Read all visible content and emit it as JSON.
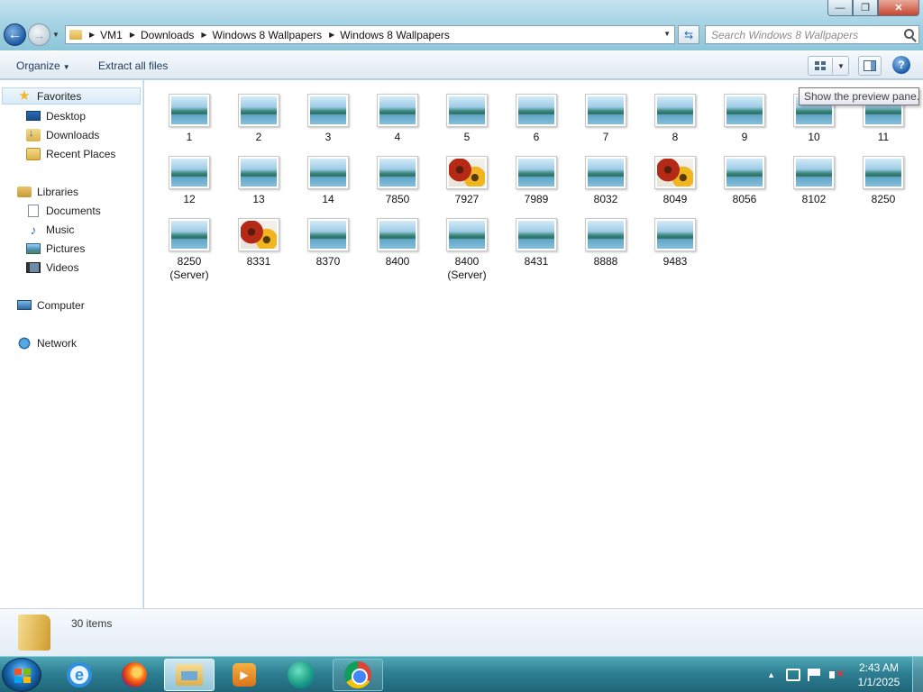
{
  "window": {
    "minimize_glyph": "—",
    "maximize_glyph": "❐",
    "close_glyph": "✕"
  },
  "nav": {
    "back_glyph": "←",
    "forward_glyph": "→",
    "history_glyph": "▼"
  },
  "address": {
    "crumbs": [
      "VM1",
      "Downloads",
      "Windows 8 Wallpapers",
      "Windows 8 Wallpapers"
    ],
    "separator_glyph": "▶",
    "dropdown_glyph": "▼",
    "refresh_glyph": "⇆"
  },
  "search": {
    "placeholder": "Search Windows 8 Wallpapers"
  },
  "toolbar": {
    "organize_label": "Organize",
    "caret_glyph": "▼",
    "extract_label": "Extract all files",
    "help_glyph": "?"
  },
  "tooltip": {
    "text": "Show the preview pane."
  },
  "sidebar": {
    "favorites_label": "Favorites",
    "desktop_label": "Desktop",
    "downloads_label": "Downloads",
    "recent_label": "Recent Places",
    "libraries_label": "Libraries",
    "documents_label": "Documents",
    "music_label": "Music",
    "pictures_label": "Pictures",
    "videos_label": "Videos",
    "computer_label": "Computer",
    "network_label": "Network",
    "star_glyph": "★",
    "music_glyph": "♪"
  },
  "files": [
    {
      "name": "1",
      "thumb": "landscape"
    },
    {
      "name": "2",
      "thumb": "landscape"
    },
    {
      "name": "3",
      "thumb": "landscape"
    },
    {
      "name": "4",
      "thumb": "landscape"
    },
    {
      "name": "5",
      "thumb": "landscape"
    },
    {
      "name": "6",
      "thumb": "landscape"
    },
    {
      "name": "7",
      "thumb": "landscape"
    },
    {
      "name": "8",
      "thumb": "landscape"
    },
    {
      "name": "9",
      "thumb": "landscape"
    },
    {
      "name": "10",
      "thumb": "landscape"
    },
    {
      "name": "11",
      "thumb": "landscape"
    },
    {
      "name": "12",
      "thumb": "landscape"
    },
    {
      "name": "13",
      "thumb": "landscape"
    },
    {
      "name": "14",
      "thumb": "landscape"
    },
    {
      "name": "7850",
      "thumb": "landscape"
    },
    {
      "name": "7927",
      "thumb": "flowers"
    },
    {
      "name": "7989",
      "thumb": "landscape"
    },
    {
      "name": "8032",
      "thumb": "landscape"
    },
    {
      "name": "8049",
      "thumb": "flowers"
    },
    {
      "name": "8056",
      "thumb": "landscape"
    },
    {
      "name": "8102",
      "thumb": "landscape"
    },
    {
      "name": "8250",
      "thumb": "landscape"
    },
    {
      "name": "8250 (Server)",
      "thumb": "landscape"
    },
    {
      "name": "8331",
      "thumb": "flowers"
    },
    {
      "name": "8370",
      "thumb": "landscape"
    },
    {
      "name": "8400",
      "thumb": "landscape"
    },
    {
      "name": "8400 (Server)",
      "thumb": "landscape"
    },
    {
      "name": "8431",
      "thumb": "landscape"
    },
    {
      "name": "8888",
      "thumb": "landscape"
    },
    {
      "name": "9483",
      "thumb": "landscape"
    }
  ],
  "status": {
    "item_count": "30 items"
  },
  "taskbar": {
    "ie_glyph": "e",
    "media_glyph": "▶",
    "tray_up_glyph": "▲",
    "time": "2:43 AM",
    "date": "1/1/2025"
  }
}
